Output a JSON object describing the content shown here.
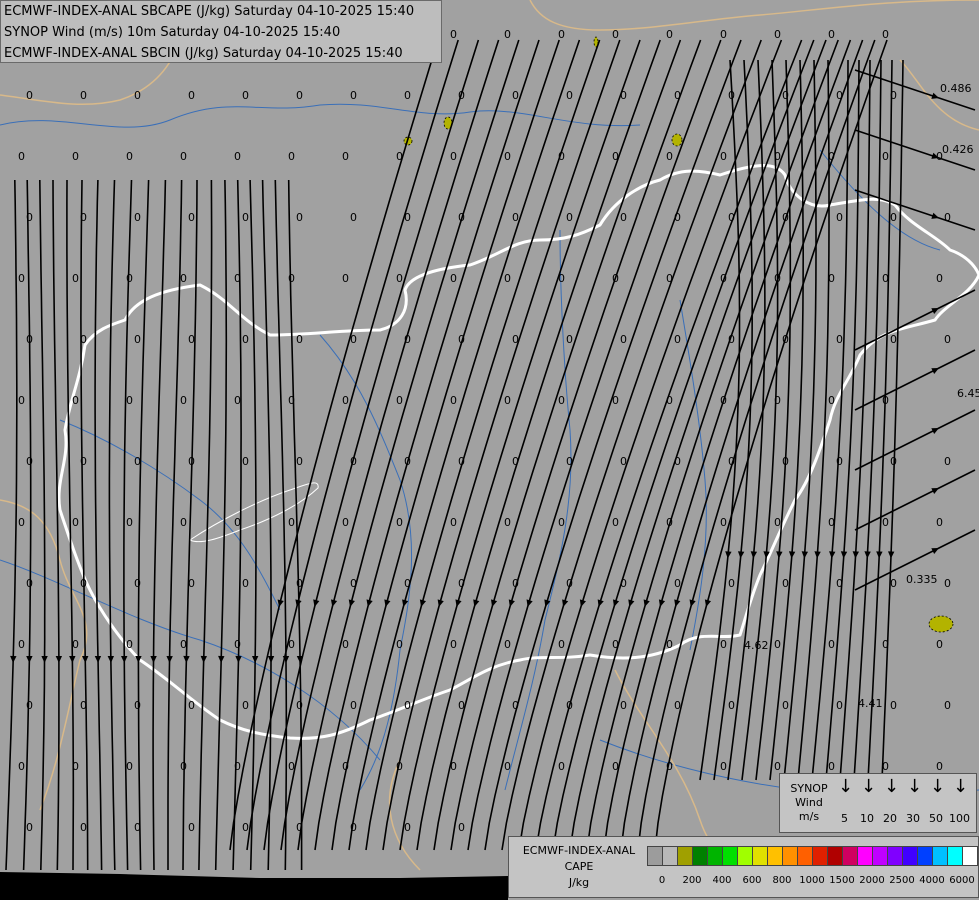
{
  "titles": [
    "ECMWF-INDEX-ANAL SBCAPE (J/kg) Saturday 04-10-2025 15:40",
    "SYNOP Wind (m/s) 10m Saturday 04-10-2025 15:40",
    "ECMWF-INDEX-ANAL SBCIN (J/kg) Saturday 04-10-2025 15:40"
  ],
  "colors": {
    "background": "#a1a1a1",
    "hungary_border": "#ffffff",
    "country_borders": "#d8b98a",
    "rivers": "#3a6fb8",
    "streamlines": "#000000",
    "cape_patches": "#b3b300"
  },
  "value_labels": [
    "0.486",
    "0.426",
    "6.45",
    "0.335",
    "4.62",
    "4.41"
  ],
  "synop_legend": {
    "title_lines": [
      "SYNOP",
      "Wind",
      "m/s"
    ],
    "arrow_icon": "down-arrow-icon",
    "speeds": [
      "5",
      "10",
      "20",
      "30",
      "50",
      "100"
    ]
  },
  "cape_legend": {
    "title_lines": [
      "ECMWF-INDEX-ANAL",
      "CAPE",
      "J/kg"
    ],
    "colors": [
      "#9c9c9c",
      "#b8b8b8",
      "#a0a000",
      "#008000",
      "#00b400",
      "#00e000",
      "#a0ff00",
      "#e0e000",
      "#ffc000",
      "#ff9000",
      "#ff6000",
      "#e02000",
      "#b00000",
      "#d00060",
      "#ff00ff",
      "#c000ff",
      "#8000ff",
      "#4000ff",
      "#0040ff",
      "#00c0ff",
      "#00ffff",
      "#ffffff"
    ],
    "ticks": [
      "0",
      "200",
      "400",
      "600",
      "800",
      "1000",
      "1500",
      "2000",
      "2500",
      "4000",
      "6000"
    ]
  }
}
